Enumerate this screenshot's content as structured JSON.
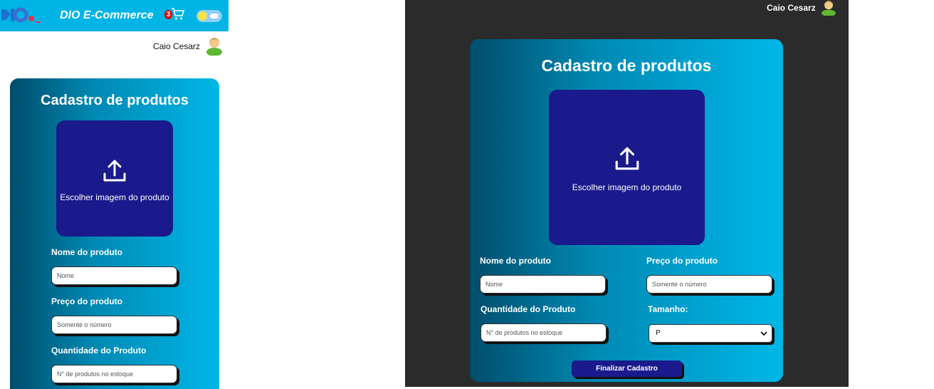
{
  "mobile": {
    "header": {
      "brand": "DIO E-Commerce",
      "cart_count": "3"
    },
    "user_name": "Caio Cesarz",
    "form": {
      "title": "Cadastro de produtos",
      "upload_text": "Escolher imagem do produto",
      "name_label": "Nome do produto",
      "name_placeholder": "Nome",
      "price_label": "Preço do produto",
      "price_placeholder": "Somente o número",
      "qty_label": "Quantidade do Produto",
      "qty_placeholder": "N° de produtos no estoque"
    }
  },
  "desktop": {
    "user_name": "Caio Cesarz",
    "form": {
      "title": "Cadastro de produtos",
      "upload_text": "Escolher imagem do produto",
      "name_label": "Nome do produto",
      "name_placeholder": "Nome",
      "price_label": "Preço do produto",
      "price_placeholder": "Somente o número",
      "qty_label": "Quantidade do Produto",
      "qty_placeholder": "N° de produtos no estoque",
      "size_label": "Tamanho:",
      "size_selected": "P",
      "submit_label": "Finalizar Cadastro"
    }
  },
  "colors": {
    "header_bg": "#00b4e6",
    "card_gradient_start": "#004d6b",
    "card_gradient_end": "#00b7e8",
    "upload_bg": "#1a1a8c",
    "dark_bg": "#2b2b2b",
    "badge": "#e00000"
  },
  "icons": {
    "logo": "dio-logo-icon",
    "cart": "cart-icon",
    "theme_toggle": "theme-toggle-icon",
    "avatar": "user-avatar-icon",
    "upload": "upload-icon",
    "select_chevron": "chevron-down-icon"
  }
}
